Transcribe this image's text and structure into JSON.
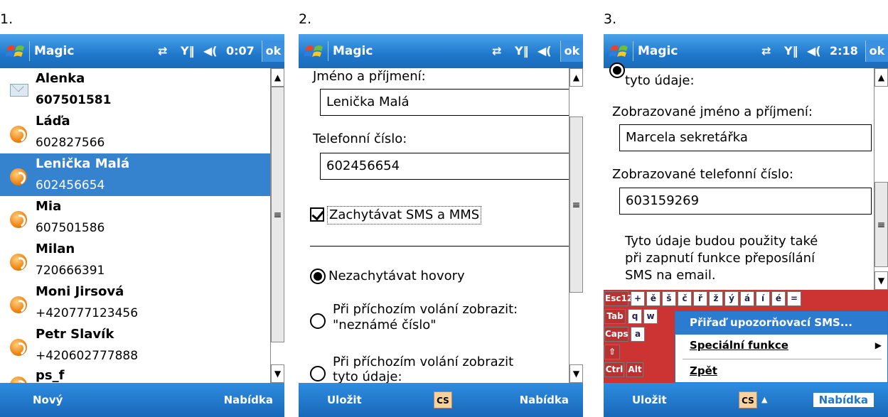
{
  "screens": [
    {
      "number": "1.",
      "title": "Magic",
      "time": "0:07",
      "ok": "ok",
      "soft_left": "Nový",
      "soft_right": "Nabídka",
      "contacts": [
        {
          "name": "Alenka",
          "phone": "607501581",
          "icon": "envelope-icon",
          "phone_bold": true
        },
        {
          "name": "Láďa",
          "phone": "602827566",
          "icon": "phone-icon"
        },
        {
          "name": "Lenička Malá",
          "phone": "602456654",
          "icon": "phone-icon",
          "selected": true
        },
        {
          "name": "Mia",
          "phone": "607501586",
          "icon": "phone-icon"
        },
        {
          "name": "Milan",
          "phone": "720666391",
          "icon": "phone-icon"
        },
        {
          "name": "Moni Jirsová",
          "phone": "+420777123456",
          "icon": "phone-icon"
        },
        {
          "name": "Petr Slavík",
          "phone": "+420602777888",
          "icon": "phone-icon"
        },
        {
          "name": "ps_f",
          "phone": "",
          "icon": "phone-icon"
        }
      ]
    },
    {
      "number": "2.",
      "title": "Magic",
      "ok": "ok",
      "name_label": "Jméno a příjmení:",
      "name_value": "Lenička Malá",
      "phone_label": "Telefonní číslo:",
      "phone_value": "602456654",
      "checkbox_label": "Zachytávat SMS a MMS",
      "checkbox_checked": true,
      "radio1": "Nezachytávat hovory",
      "radio2_line1": "Při příchozím volání zobrazit:",
      "radio2_line2": "\"neznámé číslo\"",
      "radio3_line1": "Při příchozím volání zobrazit",
      "radio3_line2": "tyto údaje:",
      "soft_left": "Uložit",
      "input_method": "CS",
      "soft_right": "Nabídka"
    },
    {
      "number": "3.",
      "title": "Magic",
      "time": "2:18",
      "ok": "ok",
      "top_text": "tyto údaje:",
      "display_name_label": "Zobrazované jméno a příjmení:",
      "display_name_value": "Marcela sekretářka",
      "display_phone_label": "Zobrazované telefonní číslo:",
      "display_phone_value": "603159269",
      "info_line1": "Tyto údaje budou použity také",
      "info_line2": "při zapnutí funkce přeposílání",
      "info_line3": "SMS na email.",
      "keyboard_row1": [
        "Esc",
        "123",
        "+",
        "ě",
        "š",
        "č",
        "ř",
        "ž",
        "ý",
        "á",
        "í",
        "é",
        "="
      ],
      "keyboard_col": [
        "Tab",
        "q",
        "w",
        "Caps",
        "a",
        "Ctrl",
        "Alt"
      ],
      "menu": {
        "item1": "Přiřaď upozorňovací SMS...",
        "item2": "Speciální funkce",
        "item3": "Zpět"
      },
      "soft_left": "Uložit",
      "input_method": "CS",
      "soft_right": "Nabídka"
    }
  ]
}
